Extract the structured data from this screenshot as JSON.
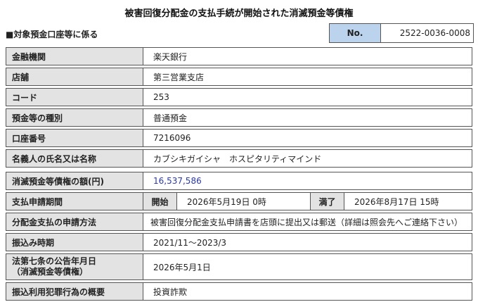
{
  "title": "被害回復分配金の支払手続が開始された消滅預金等債権",
  "section_label": "■対象預金口座等に係る",
  "no_label": "No.",
  "no_value": "2522-0036-0008",
  "rows": {
    "bank": {
      "label": "金融機関",
      "value": "楽天銀行"
    },
    "branch": {
      "label": "店舗",
      "value": "第三営業支店"
    },
    "code": {
      "label": "コード",
      "value": "253"
    },
    "type": {
      "label": "預金等の種別",
      "value": "普通預金"
    },
    "account": {
      "label": "口座番号",
      "value": "7216096"
    },
    "holder": {
      "label": "名義人の氏名又は名称",
      "value": "カブシキガイシャ　ホスピタリティマインド"
    },
    "amount": {
      "label": "消滅預金等債権の額(円)",
      "value": "16,537,586"
    },
    "period": {
      "label": "支払申請期間",
      "start_label": "開始",
      "start_value": "2026年5月19日 0時",
      "end_label": "満了",
      "end_value": "2026年8月17日 15時"
    },
    "method": {
      "label": "分配金支払の申請方法",
      "value": "被害回復分配金支払申請書を店頭に提出又は郵送（詳細は照会先へご連絡下さい）"
    },
    "transfer": {
      "label": "振込み時期",
      "value": "2021/11～2023/3"
    },
    "notice": {
      "label_line1": "法第七条の公告年月日",
      "label_line2": "（消滅預金等債権）",
      "value": "2026年5月1日"
    },
    "crime": {
      "label": "振込利用犯罪行為の概要",
      "value": "投資詐欺"
    }
  }
}
